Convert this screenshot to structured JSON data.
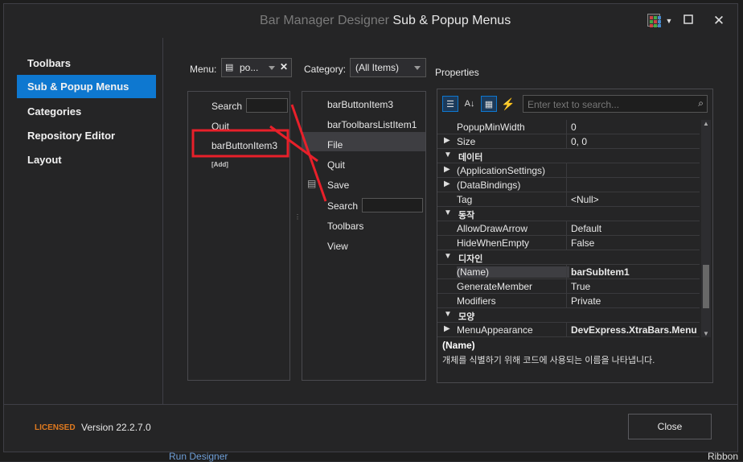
{
  "window": {
    "title_prefix": "Bar Manager Designer",
    "title_main": "Sub & Popup Menus"
  },
  "background": {
    "bottom_text": "Run Designer",
    "right_text": "Ribbon"
  },
  "sidebar": {
    "items": [
      {
        "label": "Toolbars",
        "active": false
      },
      {
        "label": "Sub & Popup Menus",
        "active": true
      },
      {
        "label": "Categories",
        "active": false
      },
      {
        "label": "Repository Editor",
        "active": false
      },
      {
        "label": "Layout",
        "active": false
      }
    ]
  },
  "menu_selector": {
    "label": "Menu:",
    "value": "po..."
  },
  "category_selector": {
    "label": "Category:",
    "value": "(All Items)"
  },
  "menu_items": {
    "items": [
      "Search",
      "Quit",
      "barButtonItem3"
    ],
    "add_label": "[Add]"
  },
  "available_items": {
    "items": [
      "barButtonItem3",
      "barToolbarsListItem1",
      "File",
      "Quit",
      "Save",
      "Search",
      "Toolbars",
      "View"
    ]
  },
  "properties": {
    "header": "Properties",
    "search_placeholder": "Enter text to search...",
    "rows": [
      {
        "exp": "",
        "name": "PopupMinWidth",
        "value": "0",
        "cat": false
      },
      {
        "exp": "▶",
        "name": "Size",
        "value": "0, 0",
        "cat": false
      },
      {
        "exp": "▼",
        "name": "데이터",
        "value": "",
        "cat": true
      },
      {
        "exp": "▶",
        "name": "(ApplicationSettings)",
        "value": "",
        "cat": false
      },
      {
        "exp": "▶",
        "name": "(DataBindings)",
        "value": "",
        "cat": false
      },
      {
        "exp": "",
        "name": "Tag",
        "value": "<Null>",
        "cat": false
      },
      {
        "exp": "▼",
        "name": "동작",
        "value": "",
        "cat": true
      },
      {
        "exp": "",
        "name": "AllowDrawArrow",
        "value": "Default",
        "cat": false
      },
      {
        "exp": "",
        "name": "HideWhenEmpty",
        "value": "False",
        "cat": false
      },
      {
        "exp": "▼",
        "name": "디자인",
        "value": "",
        "cat": true
      },
      {
        "exp": "",
        "name": "(Name)",
        "value": "barSubItem1",
        "cat": false,
        "selected": true,
        "bold": true
      },
      {
        "exp": "",
        "name": "GenerateMember",
        "value": "True",
        "cat": false
      },
      {
        "exp": "",
        "name": "Modifiers",
        "value": "Private",
        "cat": false
      },
      {
        "exp": "▼",
        "name": "모양",
        "value": "",
        "cat": true
      },
      {
        "exp": "▶",
        "name": "MenuAppearance",
        "value": "DevExpress.XtraBars.Menu",
        "cat": false,
        "bold": true
      }
    ],
    "desc_title": "(Name)",
    "desc_text": "개체를 식별하기 위해 코드에 사용되는 이름을 나타냅니다."
  },
  "footer": {
    "licensed": "LICENSED",
    "version": "Version 22.2.7.0",
    "close_label": "Close"
  },
  "colors": {
    "accent": "#0e78d0",
    "licensed": "#e07a1f",
    "annotation": "#e8202a"
  }
}
